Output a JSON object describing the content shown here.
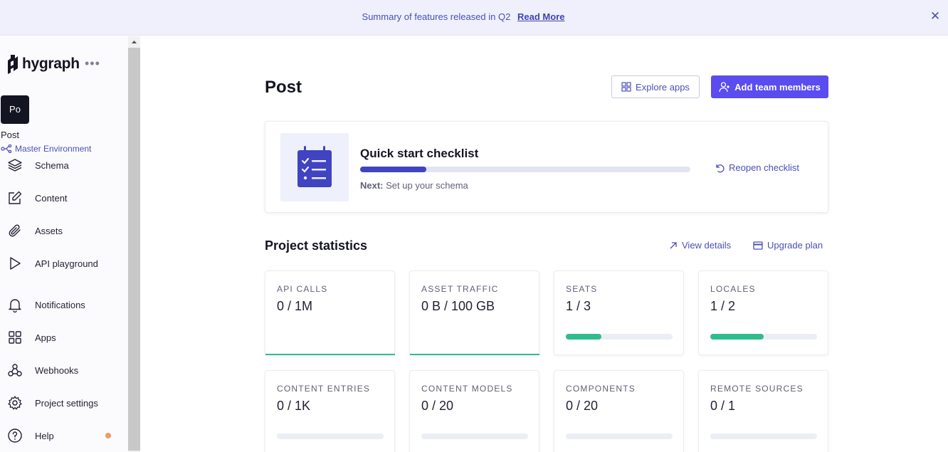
{
  "banner": {
    "message": "Summary of features released in Q2",
    "link_label": "Read More",
    "close_glyph": "✕"
  },
  "sidebar": {
    "logo_text": "hygraph",
    "more_glyph": "•••",
    "project_initials": "Po",
    "project_name": "Post",
    "environment": "Master Environment",
    "items": [
      {
        "label": "Schema",
        "icon": "layers-icon"
      },
      {
        "label": "Content",
        "icon": "edit-icon"
      },
      {
        "label": "Assets",
        "icon": "paperclip-icon"
      },
      {
        "label": "API playground",
        "icon": "play-icon"
      },
      {
        "label": "Notifications",
        "icon": "bell-icon"
      },
      {
        "label": "Apps",
        "icon": "grid-icon"
      },
      {
        "label": "Webhooks",
        "icon": "webhook-icon"
      },
      {
        "label": "Project settings",
        "icon": "gear-icon"
      },
      {
        "label": "Help",
        "icon": "help-icon"
      }
    ],
    "help_dot_color": "#f29868"
  },
  "main": {
    "title": "Post",
    "explore_apps_label": "Explore apps",
    "add_team_label": "Add team members",
    "checklist": {
      "title": "Quick start checklist",
      "progress": 0.2,
      "next_prefix": "Next:",
      "next_text": "Set up your schema",
      "reopen_label": "Reopen checklist"
    },
    "stats": {
      "title": "Project statistics",
      "view_details_label": "View details",
      "upgrade_label": "Upgrade plan",
      "cards": [
        {
          "label": "API CALLS",
          "value": "0 / 1M",
          "usage": 0
        },
        {
          "label": "ASSET TRAFFIC",
          "value": "0 B / 100 GB",
          "usage": 0
        },
        {
          "label": "SEATS",
          "value": "1 / 3",
          "usage": 0.333
        },
        {
          "label": "LOCALES",
          "value": "1 / 2",
          "usage": 0.5
        },
        {
          "label": "CONTENT ENTRIES",
          "value": "0 / 1K",
          "usage": 0
        },
        {
          "label": "CONTENT MODELS",
          "value": "0 / 20",
          "usage": 0
        },
        {
          "label": "COMPONENTS",
          "value": "0 / 20",
          "usage": 0
        },
        {
          "label": "REMOTE SOURCES",
          "value": "0 / 1",
          "usage": 0
        }
      ]
    }
  },
  "colors": {
    "accent": "#5b4cf0",
    "link": "#4b4fb8",
    "success": "#2fbd8c",
    "banner_bg": "#eff0fb"
  }
}
